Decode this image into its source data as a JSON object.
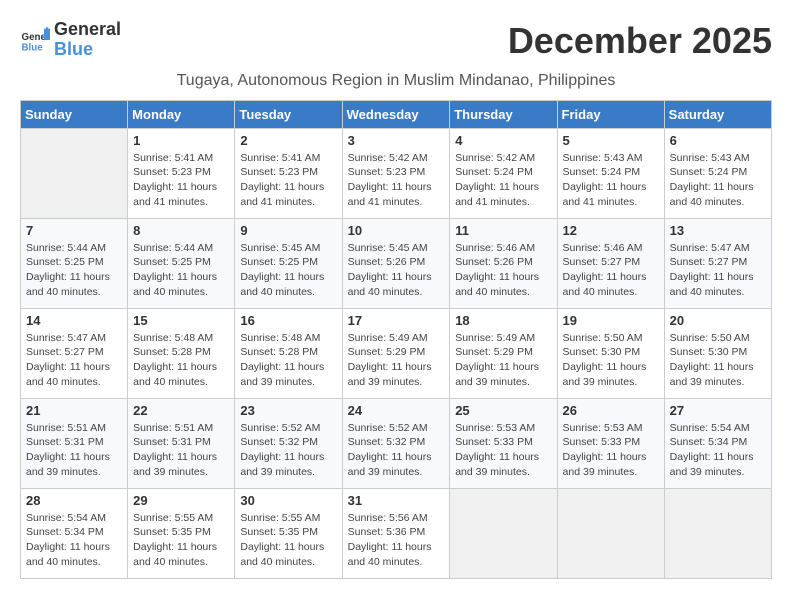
{
  "header": {
    "logo_line1": "General",
    "logo_line2": "Blue",
    "month_title": "December 2025",
    "location": "Tugaya, Autonomous Region in Muslim Mindanao, Philippines"
  },
  "weekdays": [
    "Sunday",
    "Monday",
    "Tuesday",
    "Wednesday",
    "Thursday",
    "Friday",
    "Saturday"
  ],
  "weeks": [
    [
      {
        "date": "",
        "info": ""
      },
      {
        "date": "1",
        "info": "Sunrise: 5:41 AM\nSunset: 5:23 PM\nDaylight: 11 hours\nand 41 minutes."
      },
      {
        "date": "2",
        "info": "Sunrise: 5:41 AM\nSunset: 5:23 PM\nDaylight: 11 hours\nand 41 minutes."
      },
      {
        "date": "3",
        "info": "Sunrise: 5:42 AM\nSunset: 5:23 PM\nDaylight: 11 hours\nand 41 minutes."
      },
      {
        "date": "4",
        "info": "Sunrise: 5:42 AM\nSunset: 5:24 PM\nDaylight: 11 hours\nand 41 minutes."
      },
      {
        "date": "5",
        "info": "Sunrise: 5:43 AM\nSunset: 5:24 PM\nDaylight: 11 hours\nand 41 minutes."
      },
      {
        "date": "6",
        "info": "Sunrise: 5:43 AM\nSunset: 5:24 PM\nDaylight: 11 hours\nand 40 minutes."
      }
    ],
    [
      {
        "date": "7",
        "info": "Sunrise: 5:44 AM\nSunset: 5:25 PM\nDaylight: 11 hours\nand 40 minutes."
      },
      {
        "date": "8",
        "info": "Sunrise: 5:44 AM\nSunset: 5:25 PM\nDaylight: 11 hours\nand 40 minutes."
      },
      {
        "date": "9",
        "info": "Sunrise: 5:45 AM\nSunset: 5:25 PM\nDaylight: 11 hours\nand 40 minutes."
      },
      {
        "date": "10",
        "info": "Sunrise: 5:45 AM\nSunset: 5:26 PM\nDaylight: 11 hours\nand 40 minutes."
      },
      {
        "date": "11",
        "info": "Sunrise: 5:46 AM\nSunset: 5:26 PM\nDaylight: 11 hours\nand 40 minutes."
      },
      {
        "date": "12",
        "info": "Sunrise: 5:46 AM\nSunset: 5:27 PM\nDaylight: 11 hours\nand 40 minutes."
      },
      {
        "date": "13",
        "info": "Sunrise: 5:47 AM\nSunset: 5:27 PM\nDaylight: 11 hours\nand 40 minutes."
      }
    ],
    [
      {
        "date": "14",
        "info": "Sunrise: 5:47 AM\nSunset: 5:27 PM\nDaylight: 11 hours\nand 40 minutes."
      },
      {
        "date": "15",
        "info": "Sunrise: 5:48 AM\nSunset: 5:28 PM\nDaylight: 11 hours\nand 40 minutes."
      },
      {
        "date": "16",
        "info": "Sunrise: 5:48 AM\nSunset: 5:28 PM\nDaylight: 11 hours\nand 39 minutes."
      },
      {
        "date": "17",
        "info": "Sunrise: 5:49 AM\nSunset: 5:29 PM\nDaylight: 11 hours\nand 39 minutes."
      },
      {
        "date": "18",
        "info": "Sunrise: 5:49 AM\nSunset: 5:29 PM\nDaylight: 11 hours\nand 39 minutes."
      },
      {
        "date": "19",
        "info": "Sunrise: 5:50 AM\nSunset: 5:30 PM\nDaylight: 11 hours\nand 39 minutes."
      },
      {
        "date": "20",
        "info": "Sunrise: 5:50 AM\nSunset: 5:30 PM\nDaylight: 11 hours\nand 39 minutes."
      }
    ],
    [
      {
        "date": "21",
        "info": "Sunrise: 5:51 AM\nSunset: 5:31 PM\nDaylight: 11 hours\nand 39 minutes."
      },
      {
        "date": "22",
        "info": "Sunrise: 5:51 AM\nSunset: 5:31 PM\nDaylight: 11 hours\nand 39 minutes."
      },
      {
        "date": "23",
        "info": "Sunrise: 5:52 AM\nSunset: 5:32 PM\nDaylight: 11 hours\nand 39 minutes."
      },
      {
        "date": "24",
        "info": "Sunrise: 5:52 AM\nSunset: 5:32 PM\nDaylight: 11 hours\nand 39 minutes."
      },
      {
        "date": "25",
        "info": "Sunrise: 5:53 AM\nSunset: 5:33 PM\nDaylight: 11 hours\nand 39 minutes."
      },
      {
        "date": "26",
        "info": "Sunrise: 5:53 AM\nSunset: 5:33 PM\nDaylight: 11 hours\nand 39 minutes."
      },
      {
        "date": "27",
        "info": "Sunrise: 5:54 AM\nSunset: 5:34 PM\nDaylight: 11 hours\nand 39 minutes."
      }
    ],
    [
      {
        "date": "28",
        "info": "Sunrise: 5:54 AM\nSunset: 5:34 PM\nDaylight: 11 hours\nand 40 minutes."
      },
      {
        "date": "29",
        "info": "Sunrise: 5:55 AM\nSunset: 5:35 PM\nDaylight: 11 hours\nand 40 minutes."
      },
      {
        "date": "30",
        "info": "Sunrise: 5:55 AM\nSunset: 5:35 PM\nDaylight: 11 hours\nand 40 minutes."
      },
      {
        "date": "31",
        "info": "Sunrise: 5:56 AM\nSunset: 5:36 PM\nDaylight: 11 hours\nand 40 minutes."
      },
      {
        "date": "",
        "info": ""
      },
      {
        "date": "",
        "info": ""
      },
      {
        "date": "",
        "info": ""
      }
    ]
  ]
}
